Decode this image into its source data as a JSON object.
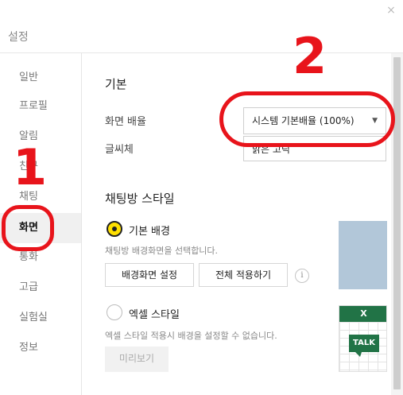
{
  "window": {
    "title": "설정",
    "close_glyph": "×"
  },
  "sidebar": {
    "items": [
      {
        "label": "일반"
      },
      {
        "label": "프로필"
      },
      {
        "label": "알림"
      },
      {
        "label": "친구"
      },
      {
        "label": "채팅"
      },
      {
        "label": "화면",
        "active": true
      },
      {
        "label": "통화"
      },
      {
        "label": "고급"
      },
      {
        "label": "실험실"
      },
      {
        "label": "정보"
      }
    ]
  },
  "basic": {
    "title": "기본",
    "zoom_label": "화면 배율",
    "zoom_value": "시스템 기본배율 (100%)",
    "font_label": "글씨체",
    "font_value": "맑은 고딕"
  },
  "chatroom_style": {
    "title": "채팅방 스타일",
    "default_bg": {
      "label": "기본 배경",
      "checked": true,
      "description": "채팅방 배경화면을 선택합니다.",
      "set_bg_button": "배경화면 설정",
      "apply_all_button": "전체 적용하기",
      "info_glyph": "i"
    },
    "excel": {
      "label": "엑셀 스타일",
      "checked": false,
      "description": "엑셀 스타일 적용시 배경을 설정할 수 없습니다.",
      "preview_button": "미리보기",
      "thumb_header": "X",
      "thumb_badge": "TALK"
    },
    "preview_bg_color": "#b2c7d9",
    "excel_green": "#217346"
  },
  "annotations": {
    "first": "1",
    "second": "2",
    "color": "#e8141b"
  }
}
